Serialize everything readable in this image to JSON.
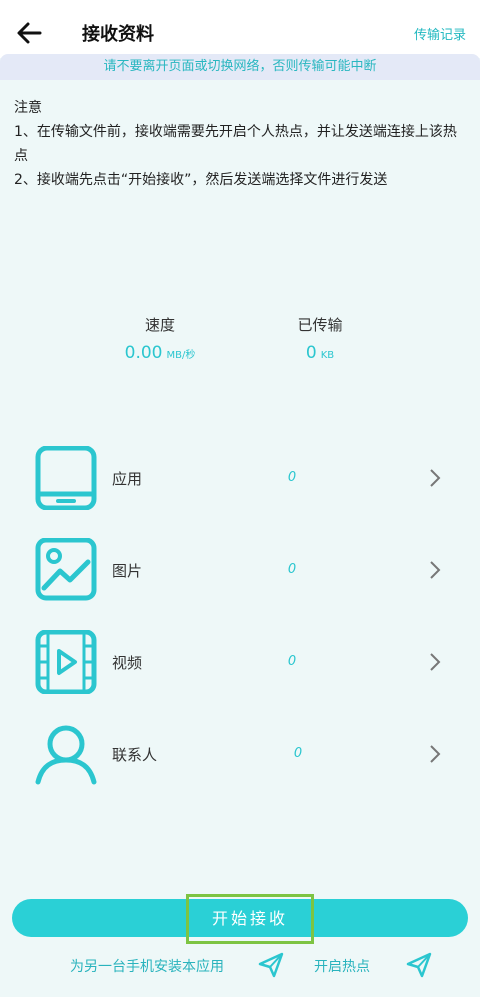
{
  "header": {
    "title": "接收资料",
    "history_link": "传输记录"
  },
  "warning": "请不要离开页面或切换网络，否则传输可能中断",
  "notes": {
    "heading": "注意",
    "line1": "1、在传输文件前，接收端需要先开启个人热点，并让发送端连接上该热点",
    "line2": "2、接收端先点击“开始接收”，然后发送端选择文件进行发送"
  },
  "stats": {
    "speed": {
      "label": "速度",
      "value": "0.00",
      "unit": "MB/秒"
    },
    "transferred": {
      "label": "已传输",
      "value": "0",
      "unit": "KB"
    }
  },
  "categories": [
    {
      "label": "应用",
      "count": "0",
      "icon": "tablet-icon"
    },
    {
      "label": "图片",
      "count": "0",
      "icon": "image-icon"
    },
    {
      "label": "视频",
      "count": "0",
      "icon": "video-icon"
    },
    {
      "label": "联系人",
      "count": "0",
      "icon": "person-icon"
    }
  ],
  "actions": {
    "start_label": "开始接收",
    "install_link": "为另一台手机安装本应用",
    "hotspot_link": "开启热点"
  },
  "colors": {
    "accent": "#2ad0d6",
    "text_accent": "#2bc6cf",
    "highlight": "#7dc443",
    "background": "#eef8f8"
  }
}
